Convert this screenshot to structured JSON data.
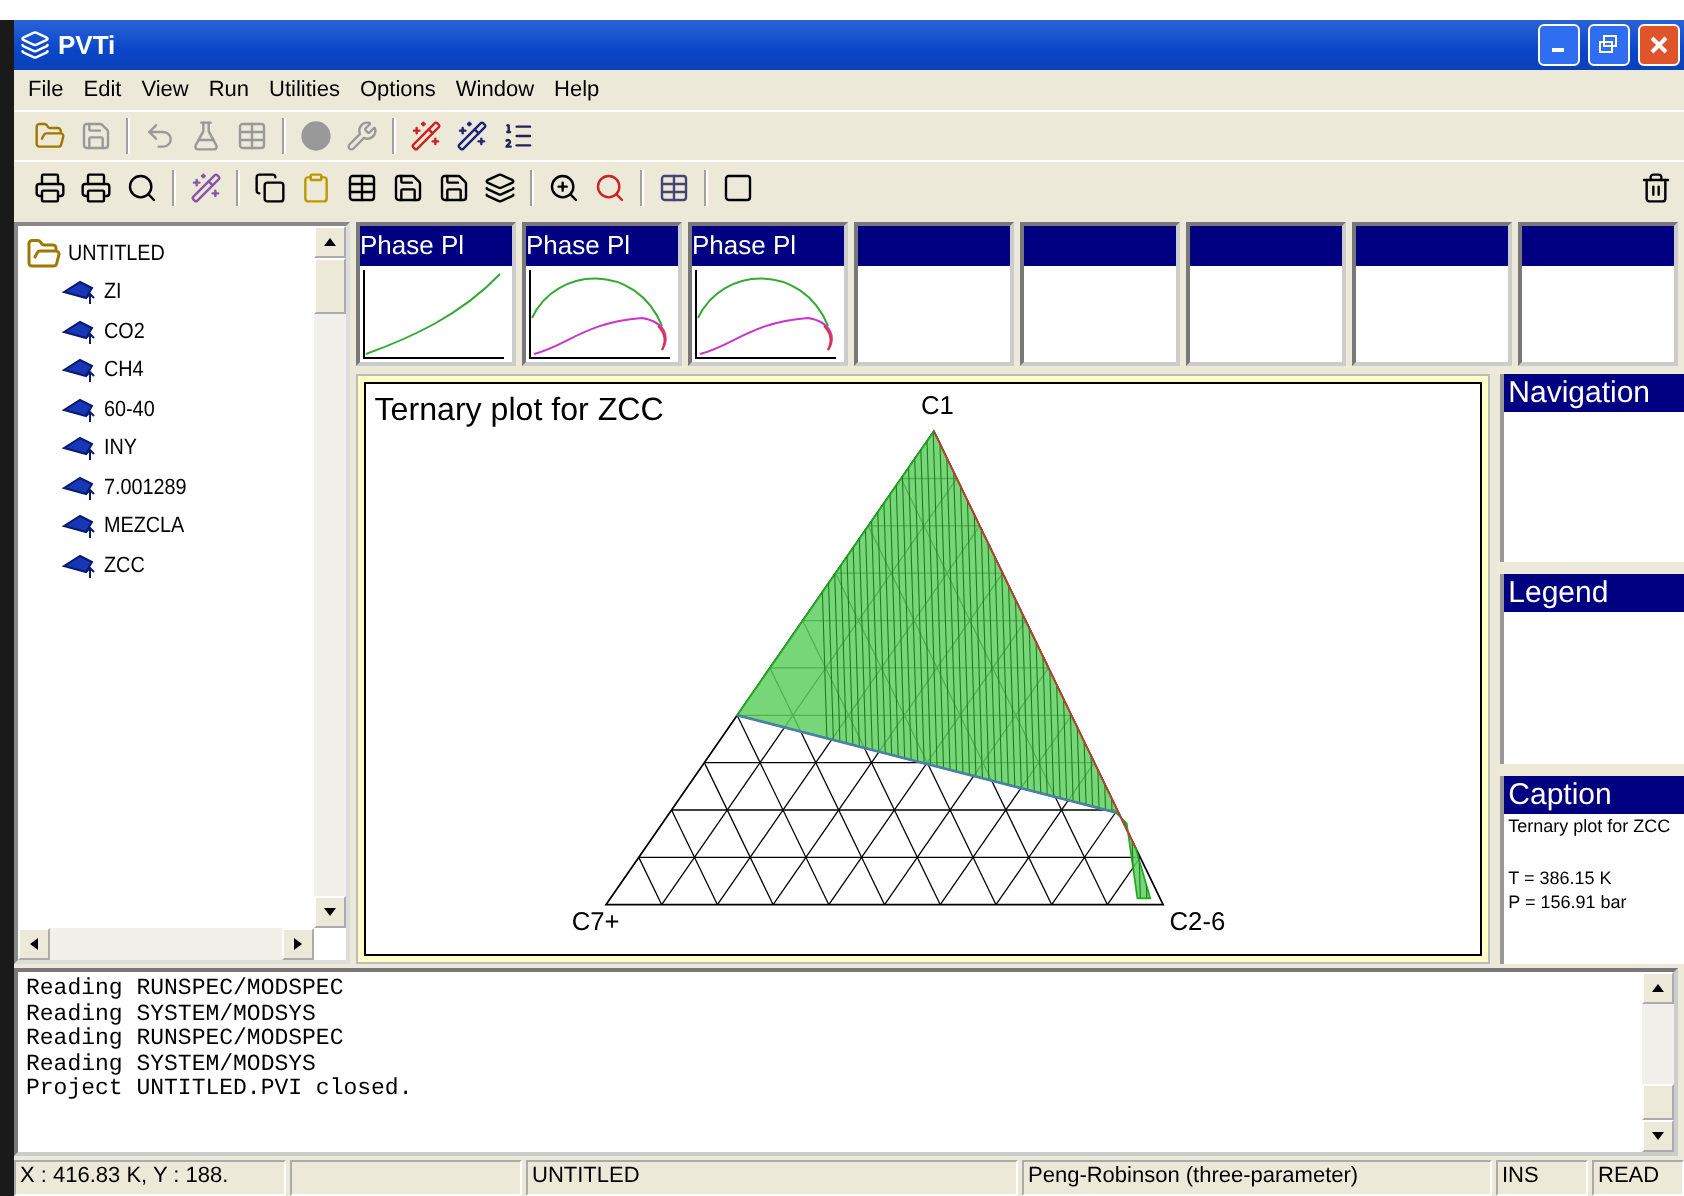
{
  "window": {
    "title": "PVTi"
  },
  "menu": [
    "File",
    "Edit",
    "View",
    "Run",
    "Utilities",
    "Options",
    "Window",
    "Help"
  ],
  "tree": {
    "label": "UNTITLED",
    "children": [
      {
        "label": "ZI"
      },
      {
        "label": "CO2"
      },
      {
        "label": "CH4"
      },
      {
        "label": "60-40"
      },
      {
        "label": "INY"
      },
      {
        "label": "7.001289"
      },
      {
        "label": "MEZCLA"
      },
      {
        "label": "ZCC"
      }
    ]
  },
  "thumbnails": [
    {
      "title": "Phase Pl",
      "kind": "line"
    },
    {
      "title": "Phase Pl",
      "kind": "envelope"
    },
    {
      "title": "Phase Pl",
      "kind": "envelope"
    },
    {
      "kind": "empty"
    },
    {
      "kind": "empty"
    },
    {
      "kind": "empty"
    },
    {
      "kind": "empty"
    },
    {
      "kind": "empty"
    }
  ],
  "plot": {
    "title": "Ternary plot for ZCC",
    "vertex_top": "C1",
    "vertex_left": "C7+",
    "vertex_right": "C2-6"
  },
  "panels": [
    {
      "title": "Navigation"
    },
    {
      "title": "Legend"
    },
    {
      "title": "Caption",
      "lines": [
        "Ternary plot for ZCC",
        "T = 386.15 K",
        "P = 156.91 bar"
      ]
    }
  ],
  "log": [
    "Reading RUNSPEC/MODSPEC",
    "Reading SYSTEM/MODSYS",
    "Reading RUNSPEC/MODSPEC",
    "Reading SYSTEM/MODSYS",
    "Project UNTITLED.PVI closed."
  ],
  "status_bar": [
    "X : 416.83 K, Y : 188.",
    "UNTITLED",
    "Peng-Robinson (three-parameter)",
    "INS",
    "READ"
  ]
}
